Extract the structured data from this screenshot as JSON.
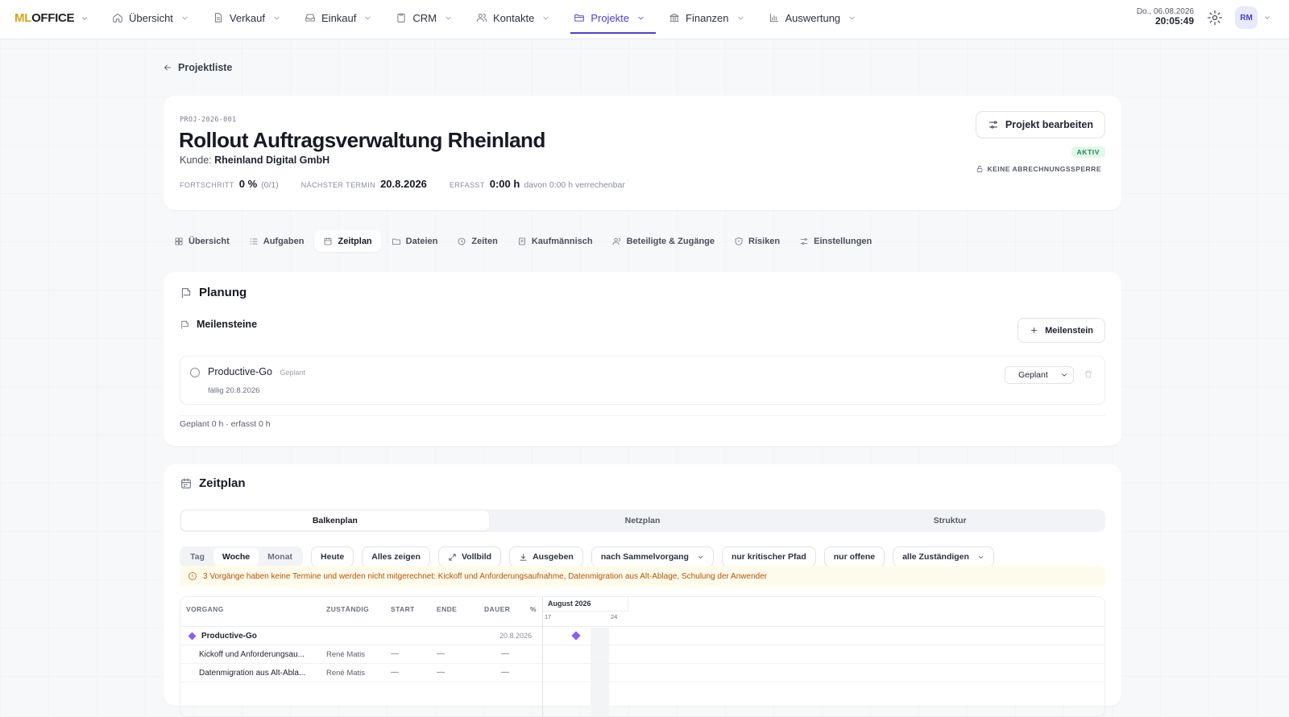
{
  "topbar": {
    "logo_ml": "ML",
    "logo_office": "OFFICE",
    "nav": [
      {
        "label": "Übersicht",
        "icon": "home-icon"
      },
      {
        "label": "Verkauf",
        "icon": "document-icon"
      },
      {
        "label": "Einkauf",
        "icon": "inbox-icon"
      },
      {
        "label": "CRM",
        "icon": "clipboard-icon"
      },
      {
        "label": "Kontakte",
        "icon": "users-icon"
      },
      {
        "label": "Projekte",
        "icon": "folder-icon",
        "active": true
      },
      {
        "label": "Finanzen",
        "icon": "bank-icon"
      },
      {
        "label": "Auswertung",
        "icon": "bar-chart-icon"
      }
    ],
    "date": "Do., 06.08.2026",
    "time": "20:05:49",
    "avatar": "RM"
  },
  "back_label": "Projektliste",
  "project": {
    "code": "PROJ-2026-001",
    "title": "Rollout Auftragsverwaltung Rheinland",
    "kunde_label": "Kunde:",
    "kunde": "Rheinland Digital GmbH",
    "fortschritt_label": "FORTSCHRITT",
    "fortschritt": "0 %",
    "fortschritt_sub": "(0/1)",
    "termin_label": "NÄCHSTER TERMIN",
    "termin": "20.8.2026",
    "erfasst_label": "ERFASST",
    "erfasst": "0:00 h",
    "erfasst_sub": "davon 0:00 h verrechenbar",
    "edit_label": "Projekt bearbeiten",
    "status": "AKTIV",
    "sperre": "KEINE ABRECHNUNGSSPERRE"
  },
  "tabs": [
    {
      "label": "Übersicht"
    },
    {
      "label": "Aufgaben"
    },
    {
      "label": "Zeitplan",
      "active": true
    },
    {
      "label": "Dateien"
    },
    {
      "label": "Zeiten"
    },
    {
      "label": "Kaufmännisch"
    },
    {
      "label": "Beteiligte & Zugänge"
    },
    {
      "label": "Risiken"
    },
    {
      "label": "Einstellungen"
    }
  ],
  "planung": {
    "title": "Planung",
    "milestones_title": "Meilensteine",
    "add_label": "Meilenstein",
    "milestone": {
      "name": "Productive-Go",
      "tag": "Geplant",
      "due": "fällig 20.8.2026",
      "status": "Geplant"
    },
    "summary": "Geplant 0 h · erfasst 0 h"
  },
  "zeitplan": {
    "title": "Zeitplan",
    "views": [
      "Balkenplan",
      "Netzplan",
      "Struktur"
    ],
    "scale": [
      "Tag",
      "Woche",
      "Monat"
    ],
    "buttons": {
      "heute": "Heute",
      "alles": "Alles zeigen",
      "vollbild": "Vollbild",
      "ausgeben": "Ausgeben",
      "sammel": "nach Sammelvorgang",
      "kritisch": "nur kritischer Pfad",
      "offene": "nur offene",
      "zustaendig": "alle Zuständigen"
    },
    "warning": "3 Vorgänge haben keine Termine und werden nicht mitgerechnet: Kickoff und Anforderungsaufnahme, Datenmigration aus Alt-Ablage, Schulung der Anwender",
    "columns": {
      "vorgang": "VORGANG",
      "zustaendig": "ZUSTÄNDIG",
      "start": "START",
      "ende": "ENDE",
      "dauer": "DAUER",
      "pct": "%"
    },
    "month": "August 2026",
    "weeks": [
      "17",
      "24"
    ],
    "rows": [
      {
        "name": "Productive-Go",
        "date": "20.8.2026"
      },
      {
        "name": "Kickoff und Anforderungsau...",
        "owner": "René Matis",
        "start": "—",
        "end": "—",
        "dur": "—"
      },
      {
        "name": "Datenmigration aus Alt-Abla...",
        "owner": "René Matis",
        "start": "—",
        "end": "—",
        "dur": "—"
      }
    ]
  }
}
